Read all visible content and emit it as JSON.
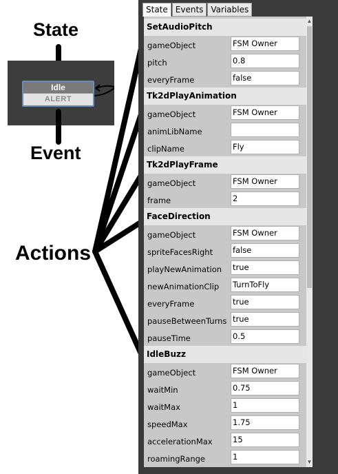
{
  "annotations": {
    "state": "State",
    "event": "Event",
    "actions": "Actions"
  },
  "node": {
    "title": "Idle",
    "event": "ALERT"
  },
  "tabs": [
    {
      "label": "State",
      "active": true
    },
    {
      "label": "Events",
      "active": false
    },
    {
      "label": "Variables",
      "active": false
    }
  ],
  "actions": [
    {
      "name": "SetAudioPitch",
      "params": [
        {
          "name": "gameObject",
          "value": "FSM Owner"
        },
        {
          "name": "pitch",
          "value": "0.8"
        },
        {
          "name": "everyFrame",
          "value": "false"
        }
      ]
    },
    {
      "name": "Tk2dPlayAnimation",
      "params": [
        {
          "name": "gameObject",
          "value": "FSM Owner"
        },
        {
          "name": "animLibName",
          "value": ""
        },
        {
          "name": "clipName",
          "value": "Fly"
        }
      ]
    },
    {
      "name": "Tk2dPlayFrame",
      "params": [
        {
          "name": "gameObject",
          "value": "FSM Owner"
        },
        {
          "name": "frame",
          "value": "2"
        }
      ]
    },
    {
      "name": "FaceDirection",
      "params": [
        {
          "name": "gameObject",
          "value": "FSM Owner"
        },
        {
          "name": "spriteFacesRight",
          "value": "false"
        },
        {
          "name": "playNewAnimation",
          "value": "true"
        },
        {
          "name": "newAnimationClip",
          "value": "TurnToFly"
        },
        {
          "name": "everyFrame",
          "value": "true"
        },
        {
          "name": "pauseBetweenTurns",
          "value": "true"
        },
        {
          "name": "pauseTime",
          "value": "0.5"
        }
      ]
    },
    {
      "name": "IdleBuzz",
      "params": [
        {
          "name": "gameObject",
          "value": "FSM Owner"
        },
        {
          "name": "waitMin",
          "value": "0.75"
        },
        {
          "name": "waitMax",
          "value": "1"
        },
        {
          "name": "speedMax",
          "value": "1.75"
        },
        {
          "name": "accelerationMax",
          "value": "15"
        },
        {
          "name": "roamingRange",
          "value": "1"
        }
      ]
    }
  ]
}
